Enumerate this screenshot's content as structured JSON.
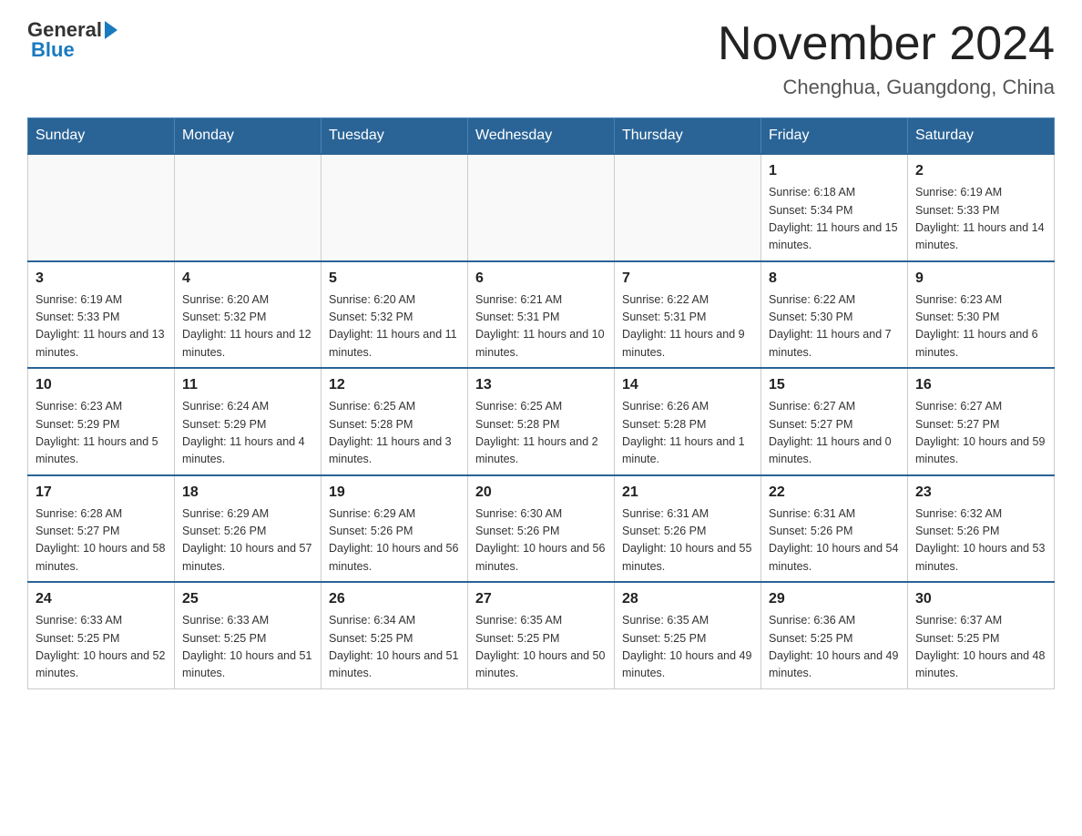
{
  "logo": {
    "text_general": "General",
    "text_blue": "Blue"
  },
  "header": {
    "title": "November 2024",
    "subtitle": "Chenghua, Guangdong, China"
  },
  "weekdays": [
    "Sunday",
    "Monday",
    "Tuesday",
    "Wednesday",
    "Thursday",
    "Friday",
    "Saturday"
  ],
  "weeks": [
    [
      {
        "day": "",
        "info": ""
      },
      {
        "day": "",
        "info": ""
      },
      {
        "day": "",
        "info": ""
      },
      {
        "day": "",
        "info": ""
      },
      {
        "day": "",
        "info": ""
      },
      {
        "day": "1",
        "info": "Sunrise: 6:18 AM\nSunset: 5:34 PM\nDaylight: 11 hours and 15 minutes."
      },
      {
        "day": "2",
        "info": "Sunrise: 6:19 AM\nSunset: 5:33 PM\nDaylight: 11 hours and 14 minutes."
      }
    ],
    [
      {
        "day": "3",
        "info": "Sunrise: 6:19 AM\nSunset: 5:33 PM\nDaylight: 11 hours and 13 minutes."
      },
      {
        "day": "4",
        "info": "Sunrise: 6:20 AM\nSunset: 5:32 PM\nDaylight: 11 hours and 12 minutes."
      },
      {
        "day": "5",
        "info": "Sunrise: 6:20 AM\nSunset: 5:32 PM\nDaylight: 11 hours and 11 minutes."
      },
      {
        "day": "6",
        "info": "Sunrise: 6:21 AM\nSunset: 5:31 PM\nDaylight: 11 hours and 10 minutes."
      },
      {
        "day": "7",
        "info": "Sunrise: 6:22 AM\nSunset: 5:31 PM\nDaylight: 11 hours and 9 minutes."
      },
      {
        "day": "8",
        "info": "Sunrise: 6:22 AM\nSunset: 5:30 PM\nDaylight: 11 hours and 7 minutes."
      },
      {
        "day": "9",
        "info": "Sunrise: 6:23 AM\nSunset: 5:30 PM\nDaylight: 11 hours and 6 minutes."
      }
    ],
    [
      {
        "day": "10",
        "info": "Sunrise: 6:23 AM\nSunset: 5:29 PM\nDaylight: 11 hours and 5 minutes."
      },
      {
        "day": "11",
        "info": "Sunrise: 6:24 AM\nSunset: 5:29 PM\nDaylight: 11 hours and 4 minutes."
      },
      {
        "day": "12",
        "info": "Sunrise: 6:25 AM\nSunset: 5:28 PM\nDaylight: 11 hours and 3 minutes."
      },
      {
        "day": "13",
        "info": "Sunrise: 6:25 AM\nSunset: 5:28 PM\nDaylight: 11 hours and 2 minutes."
      },
      {
        "day": "14",
        "info": "Sunrise: 6:26 AM\nSunset: 5:28 PM\nDaylight: 11 hours and 1 minute."
      },
      {
        "day": "15",
        "info": "Sunrise: 6:27 AM\nSunset: 5:27 PM\nDaylight: 11 hours and 0 minutes."
      },
      {
        "day": "16",
        "info": "Sunrise: 6:27 AM\nSunset: 5:27 PM\nDaylight: 10 hours and 59 minutes."
      }
    ],
    [
      {
        "day": "17",
        "info": "Sunrise: 6:28 AM\nSunset: 5:27 PM\nDaylight: 10 hours and 58 minutes."
      },
      {
        "day": "18",
        "info": "Sunrise: 6:29 AM\nSunset: 5:26 PM\nDaylight: 10 hours and 57 minutes."
      },
      {
        "day": "19",
        "info": "Sunrise: 6:29 AM\nSunset: 5:26 PM\nDaylight: 10 hours and 56 minutes."
      },
      {
        "day": "20",
        "info": "Sunrise: 6:30 AM\nSunset: 5:26 PM\nDaylight: 10 hours and 56 minutes."
      },
      {
        "day": "21",
        "info": "Sunrise: 6:31 AM\nSunset: 5:26 PM\nDaylight: 10 hours and 55 minutes."
      },
      {
        "day": "22",
        "info": "Sunrise: 6:31 AM\nSunset: 5:26 PM\nDaylight: 10 hours and 54 minutes."
      },
      {
        "day": "23",
        "info": "Sunrise: 6:32 AM\nSunset: 5:26 PM\nDaylight: 10 hours and 53 minutes."
      }
    ],
    [
      {
        "day": "24",
        "info": "Sunrise: 6:33 AM\nSunset: 5:25 PM\nDaylight: 10 hours and 52 minutes."
      },
      {
        "day": "25",
        "info": "Sunrise: 6:33 AM\nSunset: 5:25 PM\nDaylight: 10 hours and 51 minutes."
      },
      {
        "day": "26",
        "info": "Sunrise: 6:34 AM\nSunset: 5:25 PM\nDaylight: 10 hours and 51 minutes."
      },
      {
        "day": "27",
        "info": "Sunrise: 6:35 AM\nSunset: 5:25 PM\nDaylight: 10 hours and 50 minutes."
      },
      {
        "day": "28",
        "info": "Sunrise: 6:35 AM\nSunset: 5:25 PM\nDaylight: 10 hours and 49 minutes."
      },
      {
        "day": "29",
        "info": "Sunrise: 6:36 AM\nSunset: 5:25 PM\nDaylight: 10 hours and 49 minutes."
      },
      {
        "day": "30",
        "info": "Sunrise: 6:37 AM\nSunset: 5:25 PM\nDaylight: 10 hours and 48 minutes."
      }
    ]
  ]
}
